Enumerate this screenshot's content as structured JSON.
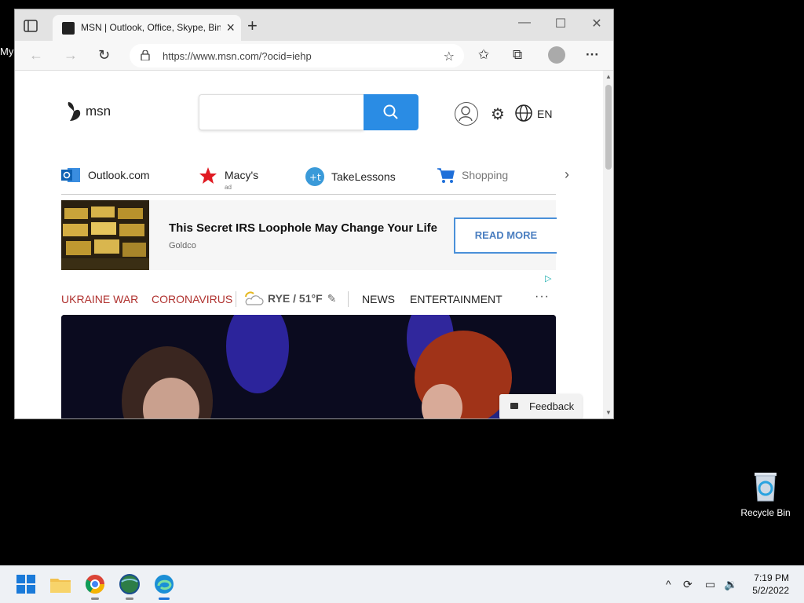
{
  "desktop": {
    "left_label": "My",
    "recycle_bin_label": "Recycle Bin"
  },
  "browser": {
    "tab_title": "MSN | Outlook, Office, Skype, Bing",
    "url": "https://www.msn.com/?ocid=iehp"
  },
  "msn": {
    "logo_text": "msn",
    "language": "EN",
    "quick_links": [
      {
        "label": "Outlook.com"
      },
      {
        "label": "Macy's",
        "ad": "ad"
      },
      {
        "label": "TakeLessons"
      },
      {
        "label": "Shopping"
      }
    ],
    "ad": {
      "headline": "This Secret IRS Loophole May Change Your Life",
      "source": "Goldco",
      "cta": "READ MORE"
    },
    "topics": {
      "t1": "UKRAINE WAR",
      "t2": "CORONAVIRUS",
      "weather": "RYE / 51°F",
      "t3": "NEWS",
      "t4": "ENTERTAINMENT"
    },
    "feedback_label": "Feedback"
  },
  "taskbar": {
    "time": "7:19 PM",
    "date": "5/2/2022"
  }
}
